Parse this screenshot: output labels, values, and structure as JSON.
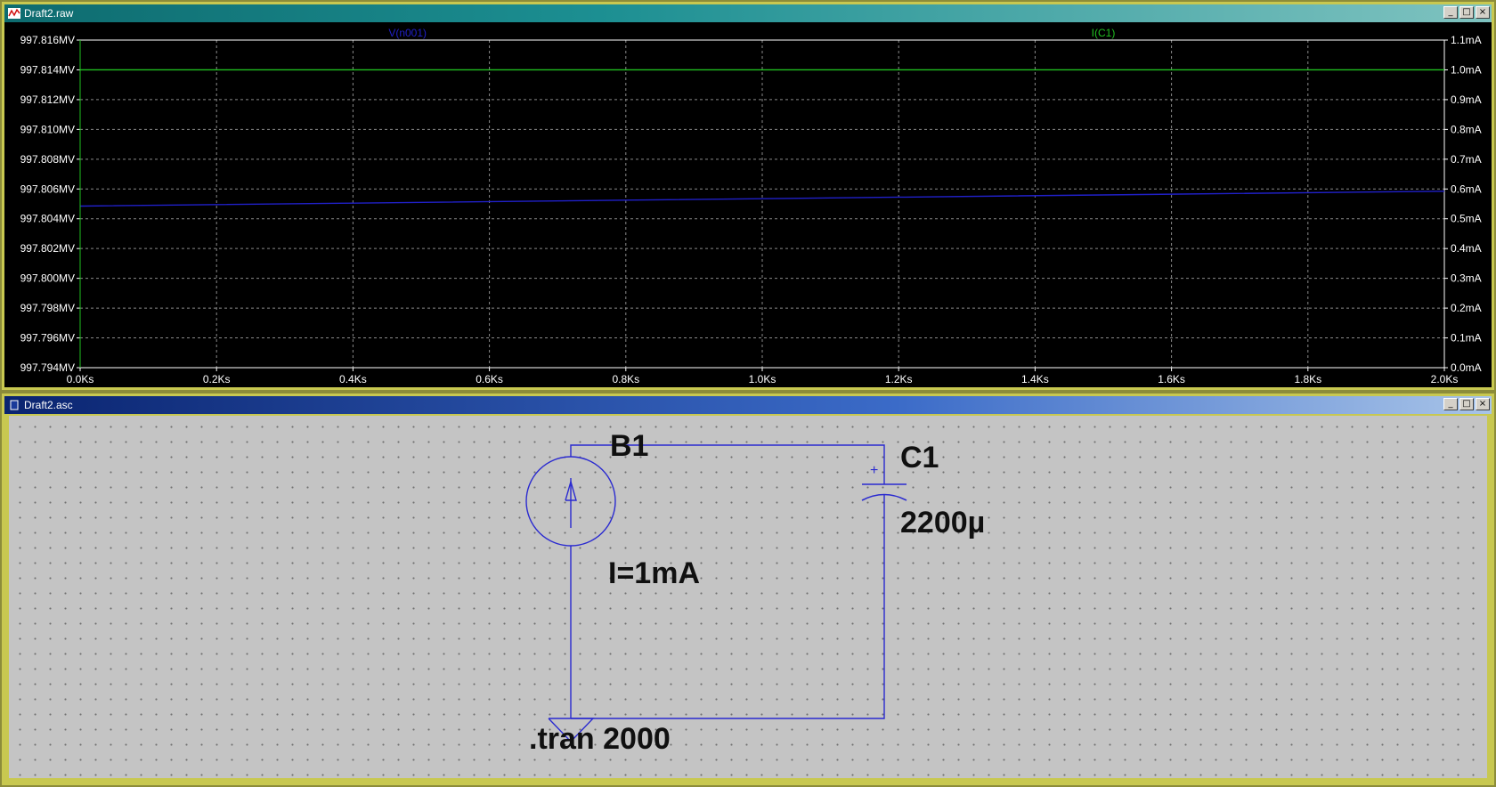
{
  "plot_window": {
    "title": "Draft2.raw",
    "buttons": [
      "_",
      "□",
      "×"
    ]
  },
  "schematic_window": {
    "title": "Draft2.asc",
    "buttons": [
      "_",
      "□",
      "×"
    ]
  },
  "chart_data": {
    "type": "line",
    "title": "",
    "x_ticks": [
      "0.0Ks",
      "0.2Ks",
      "0.4Ks",
      "0.6Ks",
      "0.8Ks",
      "1.0Ks",
      "1.2Ks",
      "1.4Ks",
      "1.6Ks",
      "1.8Ks",
      "2.0Ks"
    ],
    "y_left_ticks": [
      "997.816MV",
      "997.814MV",
      "997.812MV",
      "997.810MV",
      "997.808MV",
      "997.806MV",
      "997.804MV",
      "997.802MV",
      "997.800MV",
      "997.798MV",
      "997.796MV",
      "997.794MV"
    ],
    "y_right_ticks": [
      "1.1mA",
      "1.0mA",
      "0.9mA",
      "0.8mA",
      "0.7mA",
      "0.6mA",
      "0.5mA",
      "0.4mA",
      "0.3mA",
      "0.2mA",
      "0.1mA",
      "0.0mA"
    ],
    "xlim": [
      0,
      2000
    ],
    "ylim_left": [
      997.794,
      997.816
    ],
    "ylim_right": [
      0,
      1.1
    ],
    "grid": true,
    "series": [
      {
        "name": "V(n001)",
        "axis": "left",
        "color": "#2020c8",
        "x": [
          0,
          400,
          800,
          1200,
          1600,
          2000
        ],
        "y": [
          997.80485,
          997.80505,
          997.80525,
          997.80545,
          997.80565,
          997.80585
        ]
      },
      {
        "name": "I(C1)",
        "axis": "right",
        "color": "#20c020",
        "x": [
          0,
          2000
        ],
        "y": [
          1.0,
          1.0
        ]
      }
    ]
  },
  "schematic": {
    "source_label": "B1",
    "source_value": "I=1mA",
    "cap_label": "C1",
    "cap_value": "2200µ",
    "cap_plus": "+",
    "directive": ".tran 2000",
    "wire_color": "#2a2ad0"
  }
}
